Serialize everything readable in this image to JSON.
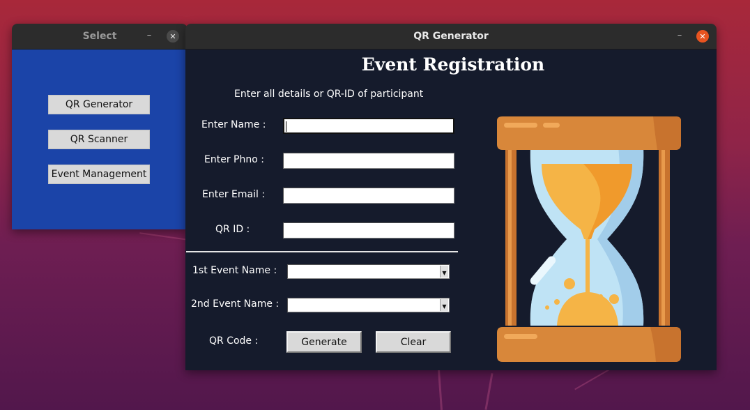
{
  "select_window": {
    "title": "Select",
    "minimize": "–",
    "close": "✕",
    "buttons": [
      "QR Generator",
      "QR Scanner",
      "Event Management"
    ]
  },
  "qr_window": {
    "title": "QR Generator",
    "minimize": "–",
    "close": "✕",
    "heading": "Event Registration",
    "subtitle": "Enter all details or QR-ID of participant",
    "fields": [
      {
        "label": "Enter Name :",
        "value": ""
      },
      {
        "label": "Enter Phno :",
        "value": ""
      },
      {
        "label": "Enter Email :",
        "value": ""
      },
      {
        "label": "QR ID :",
        "value": ""
      }
    ],
    "events": [
      {
        "label": "1st Event Name :",
        "value": ""
      },
      {
        "label": "2nd Event Name :",
        "value": ""
      }
    ],
    "qr_code_label": "QR Code :",
    "generate_label": "Generate",
    "clear_label": "Clear",
    "illustration": "hourglass-icon"
  },
  "colors": {
    "select_bg": "#1b44a8",
    "qr_bg": "#151b2c",
    "close_accent": "#e95420",
    "hourglass_frame": "#d8873a",
    "sand": "#f5b446",
    "glass": "#bfe3f5"
  }
}
